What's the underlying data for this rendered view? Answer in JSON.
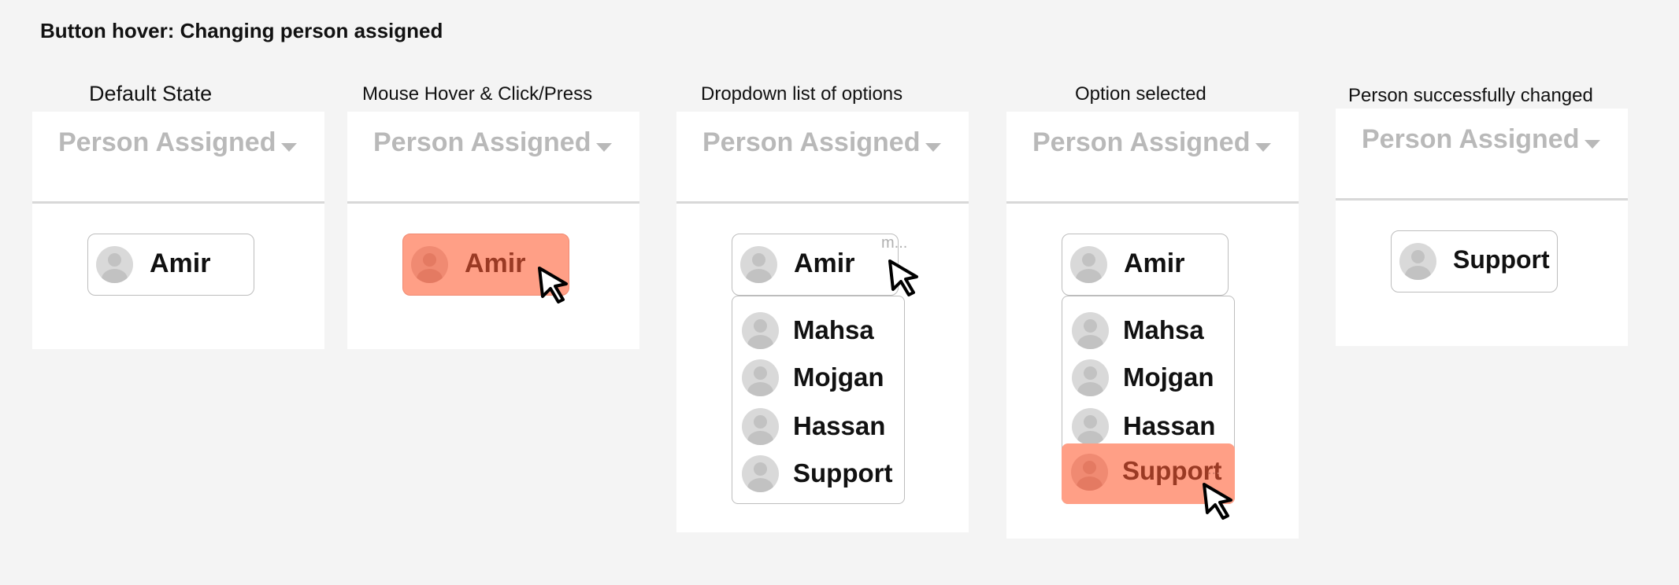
{
  "page_title": "Button hover: Changing person assigned",
  "header_label": "Person Assigned",
  "states": [
    {
      "label": "Default State",
      "selected": "Amir"
    },
    {
      "label": "Mouse Hover & Click/Press",
      "selected": "Amir"
    },
    {
      "label": "Dropdown list of options",
      "selected": "Amir",
      "hint": "m..."
    },
    {
      "label": "Option selected",
      "selected": "Amir",
      "hint": "..."
    },
    {
      "label": "Person successfully changed",
      "selected": "Support"
    }
  ],
  "options": [
    "Mahsa",
    "Mojgan",
    "Hassan",
    "Support"
  ],
  "colors": {
    "hover_bg": "#ff9f86",
    "hover_text": "#9a3a24",
    "header_text": "#b9b9b9",
    "canvas_bg": "#f4f4f4"
  },
  "icons": [
    "caret-down-icon",
    "avatar-icon",
    "cursor-arrow-icon"
  ]
}
